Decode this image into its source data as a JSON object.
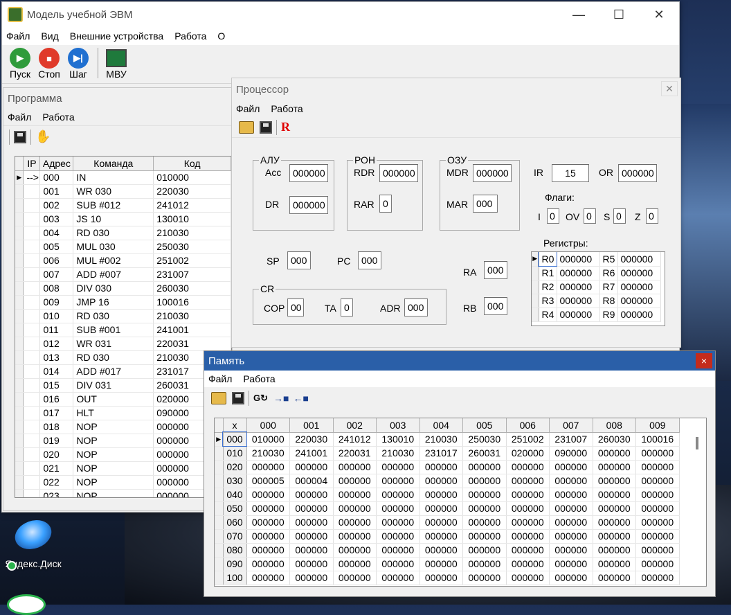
{
  "main": {
    "title": "Модель учебной ЭВМ",
    "menu": [
      "Файл",
      "Вид",
      "Внешние устройства",
      "Работа",
      "О"
    ],
    "toolbar": [
      {
        "label": "Пуск",
        "color": "#2f9b3b",
        "icon": "play-icon"
      },
      {
        "label": "Стоп",
        "color": "#e03a2a",
        "icon": "stop-icon"
      },
      {
        "label": "Шаг",
        "color": "#1f6fd0",
        "icon": "step-icon"
      },
      {
        "label": "МВУ",
        "icon": "device-icon"
      }
    ]
  },
  "program": {
    "title": "Программа",
    "menu": [
      "Файл",
      "Работа"
    ],
    "columns": [
      "IP",
      "Адрес",
      "Команда",
      "Код"
    ],
    "ip_marker": "-->",
    "rows": [
      [
        "000",
        "IN",
        "010000"
      ],
      [
        "001",
        "WR 030",
        "220030"
      ],
      [
        "002",
        "SUB #012",
        "241012"
      ],
      [
        "003",
        "JS 10",
        "130010"
      ],
      [
        "004",
        "RD 030",
        "210030"
      ],
      [
        "005",
        "MUL 030",
        "250030"
      ],
      [
        "006",
        "MUL #002",
        "251002"
      ],
      [
        "007",
        "ADD #007",
        "231007"
      ],
      [
        "008",
        "DIV 030",
        "260030"
      ],
      [
        "009",
        "JMP 16",
        "100016"
      ],
      [
        "010",
        "RD 030",
        "210030"
      ],
      [
        "011",
        "SUB #001",
        "241001"
      ],
      [
        "012",
        "WR 031",
        "220031"
      ],
      [
        "013",
        "RD 030",
        "210030"
      ],
      [
        "014",
        "ADD #017",
        "231017"
      ],
      [
        "015",
        "DIV 031",
        "260031"
      ],
      [
        "016",
        "OUT",
        "020000"
      ],
      [
        "017",
        "HLT",
        "090000"
      ],
      [
        "018",
        "NOP",
        "000000"
      ],
      [
        "019",
        "NOP",
        "000000"
      ],
      [
        "020",
        "NOP",
        "000000"
      ],
      [
        "021",
        "NOP",
        "000000"
      ],
      [
        "022",
        "NOP",
        "000000"
      ],
      [
        "023",
        "NOP",
        "000000"
      ]
    ]
  },
  "processor": {
    "title": "Процессор",
    "menu": [
      "Файл",
      "Работа"
    ],
    "r_label": "R",
    "alu": {
      "title": "АЛУ",
      "acc_label": "Acc",
      "acc": "000000",
      "dr_label": "DR",
      "dr": "000000"
    },
    "ron": {
      "title": "РОН",
      "rdr_label": "RDR",
      "rdr": "000000",
      "rar_label": "RAR",
      "rar": "0"
    },
    "ozu": {
      "title": "ОЗУ",
      "mdr_label": "MDR",
      "mdr": "000000",
      "mar_label": "MAR",
      "mar": "000"
    },
    "ir_label": "IR",
    "ir": "15",
    "or_label": "OR",
    "or": "000000",
    "flags_title": "Флаги:",
    "flags": [
      {
        "name": "I",
        "value": "0"
      },
      {
        "name": "OV",
        "value": "0"
      },
      {
        "name": "S",
        "value": "0"
      },
      {
        "name": "Z",
        "value": "0"
      }
    ],
    "sp_label": "SP",
    "sp": "000",
    "pc_label": "PC",
    "pc": "000",
    "cr": {
      "title": "CR",
      "cop_label": "COP",
      "cop": "00",
      "ta_label": "TA",
      "ta": "0",
      "adr_label": "ADR",
      "adr": "000"
    },
    "ra_label": "RA",
    "ra": "000",
    "rb_label": "RB",
    "rb": "000",
    "registers_title": "Регистры:",
    "registers": [
      [
        "R0",
        "000000",
        "R5",
        "000000"
      ],
      [
        "R1",
        "000000",
        "R6",
        "000000"
      ],
      [
        "R2",
        "000000",
        "R7",
        "000000"
      ],
      [
        "R3",
        "000000",
        "R8",
        "000000"
      ],
      [
        "R4",
        "000000",
        "R9",
        "000000"
      ]
    ]
  },
  "memory": {
    "title": "Память",
    "menu": [
      "Файл",
      "Работа"
    ],
    "close": "×",
    "columns": [
      "x",
      "000",
      "001",
      "002",
      "003",
      "004",
      "005",
      "006",
      "007",
      "008",
      "009"
    ],
    "rows": [
      [
        "000",
        "010000",
        "220030",
        "241012",
        "130010",
        "210030",
        "250030",
        "251002",
        "231007",
        "260030",
        "100016"
      ],
      [
        "010",
        "210030",
        "241001",
        "220031",
        "210030",
        "231017",
        "260031",
        "020000",
        "090000",
        "000000",
        "000000"
      ],
      [
        "020",
        "000000",
        "000000",
        "000000",
        "000000",
        "000000",
        "000000",
        "000000",
        "000000",
        "000000",
        "000000"
      ],
      [
        "030",
        "000005",
        "000004",
        "000000",
        "000000",
        "000000",
        "000000",
        "000000",
        "000000",
        "000000",
        "000000"
      ],
      [
        "040",
        "000000",
        "000000",
        "000000",
        "000000",
        "000000",
        "000000",
        "000000",
        "000000",
        "000000",
        "000000"
      ],
      [
        "050",
        "000000",
        "000000",
        "000000",
        "000000",
        "000000",
        "000000",
        "000000",
        "000000",
        "000000",
        "000000"
      ],
      [
        "060",
        "000000",
        "000000",
        "000000",
        "000000",
        "000000",
        "000000",
        "000000",
        "000000",
        "000000",
        "000000"
      ],
      [
        "070",
        "000000",
        "000000",
        "000000",
        "000000",
        "000000",
        "000000",
        "000000",
        "000000",
        "000000",
        "000000"
      ],
      [
        "080",
        "000000",
        "000000",
        "000000",
        "000000",
        "000000",
        "000000",
        "000000",
        "000000",
        "000000",
        "000000"
      ],
      [
        "090",
        "000000",
        "000000",
        "000000",
        "000000",
        "000000",
        "000000",
        "000000",
        "000000",
        "000000",
        "000000"
      ],
      [
        "100",
        "000000",
        "000000",
        "000000",
        "000000",
        "000000",
        "000000",
        "000000",
        "000000",
        "000000",
        "000000"
      ]
    ]
  },
  "desktop": {
    "icon_label": "Яндекс.Диск"
  }
}
